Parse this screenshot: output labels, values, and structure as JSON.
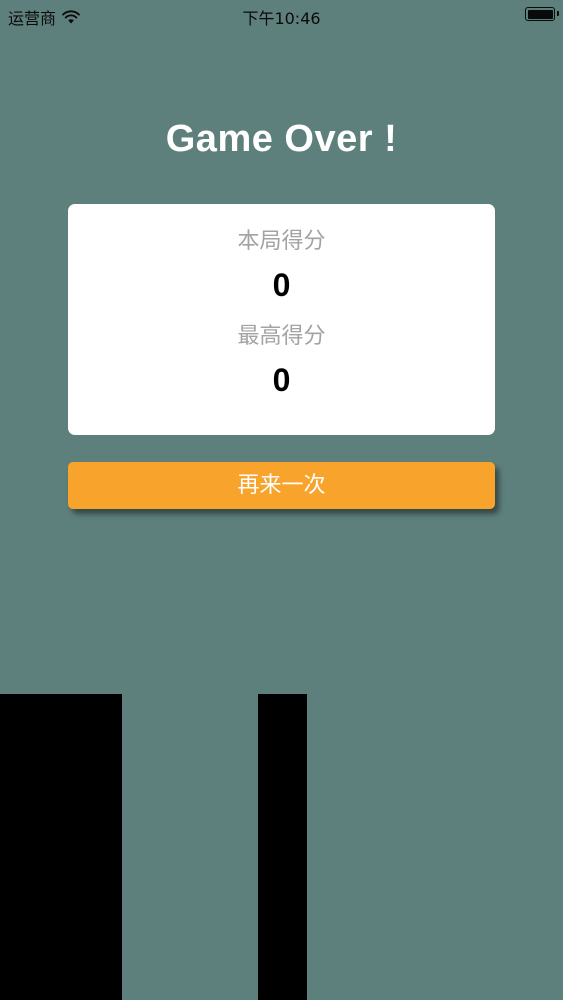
{
  "status_bar": {
    "carrier": "运营商",
    "time": "下午10:46",
    "wifi_icon": "wifi-icon",
    "battery_icon": "battery-icon"
  },
  "game": {
    "title": "Game Over !",
    "current_score_label": "本局得分",
    "current_score": "0",
    "best_score_label": "最高得分",
    "best_score": "0",
    "retry_label": "再来一次"
  },
  "colors": {
    "background": "#5e807c",
    "card": "#ffffff",
    "button": "#f8a42c",
    "pillar": "#000000"
  }
}
